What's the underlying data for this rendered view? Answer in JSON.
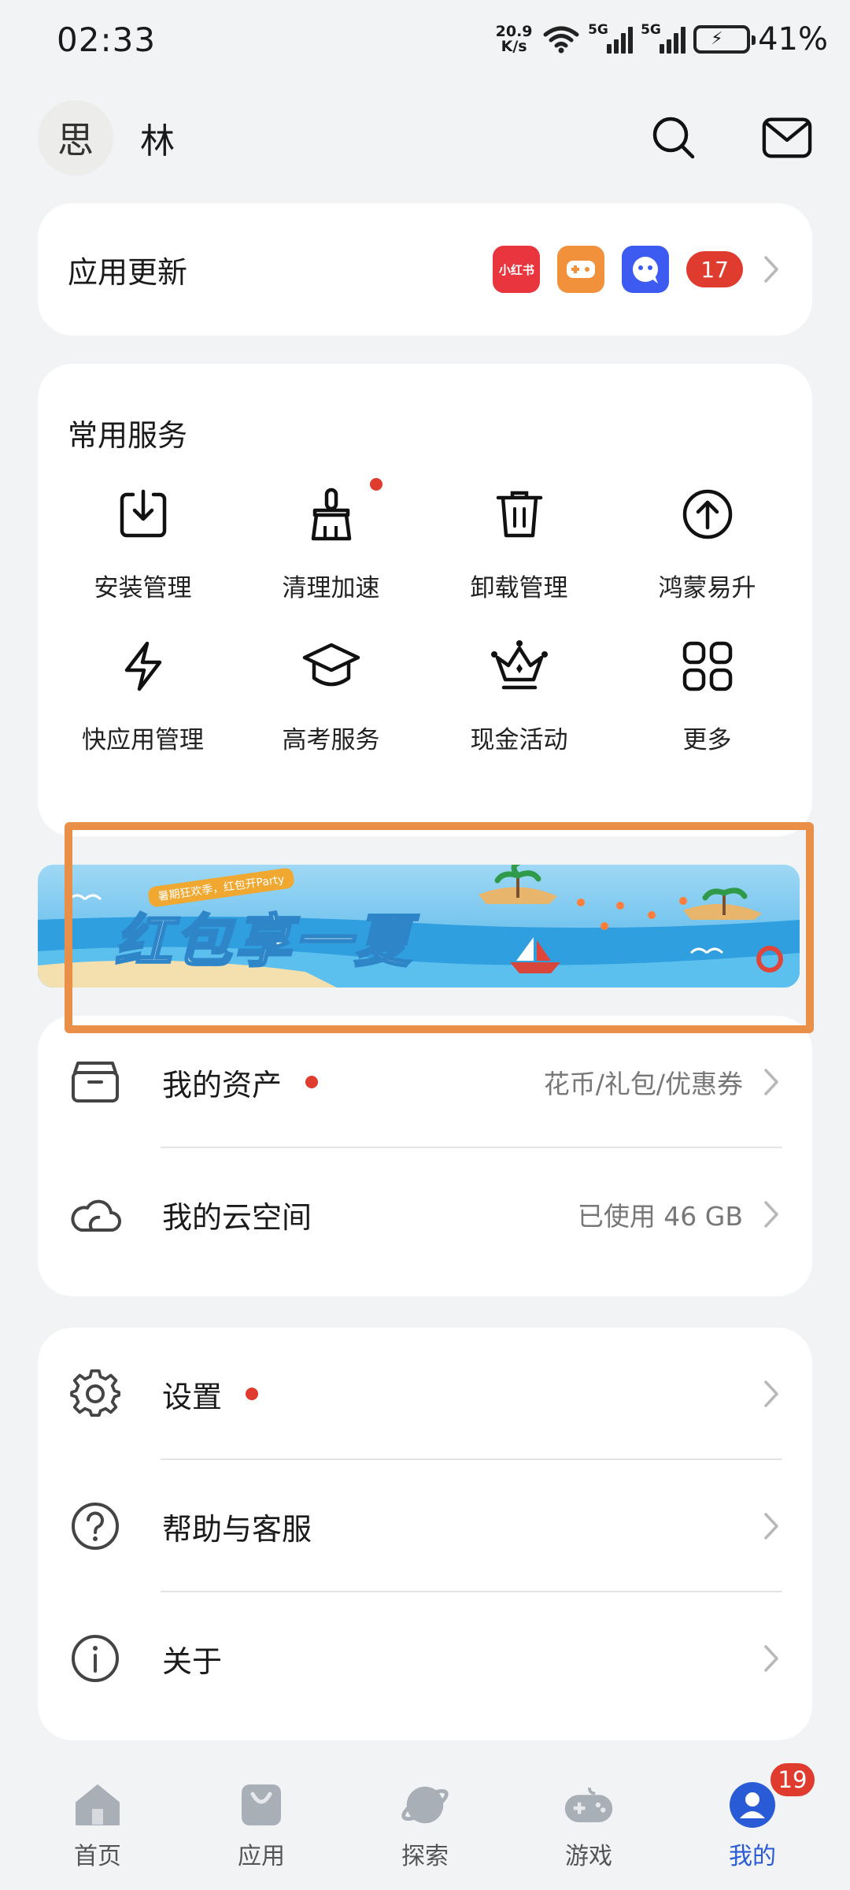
{
  "status_bar": {
    "time": "02:33",
    "net_speed_value": "20.9",
    "net_speed_unit": "K/s",
    "signal_1": "5G",
    "signal_2": "5G",
    "battery_percent": "41%"
  },
  "profile": {
    "avatar_char": "思",
    "name": "林",
    "search_icon": "search-icon",
    "mail_icon": "mail-icon"
  },
  "app_update": {
    "title": "应用更新",
    "apps": [
      {
        "label": "小红书",
        "color": "#e8353e"
      },
      {
        "label": "",
        "color": "#f2913b"
      },
      {
        "label": "",
        "color": "#3d5bf0"
      }
    ],
    "count": "17"
  },
  "services": {
    "title": "常用服务",
    "items": [
      {
        "label": "安装管理",
        "icon": "download-box-icon"
      },
      {
        "label": "清理加速",
        "icon": "brush-icon",
        "dot": true
      },
      {
        "label": "卸载管理",
        "icon": "trash-icon"
      },
      {
        "label": "鸿蒙易升",
        "icon": "arrow-up-circle-icon"
      },
      {
        "label": "快应用管理",
        "icon": "lightning-icon"
      },
      {
        "label": "高考服务",
        "icon": "graduation-cap-icon"
      },
      {
        "label": "现金活动",
        "icon": "crown-icon"
      },
      {
        "label": "更多",
        "icon": "grid-icon"
      }
    ]
  },
  "banner": {
    "ribbon": "暑期狂欢季，红包开Party",
    "headline": "红包享一夏"
  },
  "assets": {
    "rows": [
      {
        "label": "我的资产",
        "value": "花币/礼包/优惠券",
        "icon": "wallet-box-icon",
        "dot": true
      },
      {
        "label": "我的云空间",
        "value": "已使用 46 GB",
        "icon": "cloud-icon",
        "dot": false
      }
    ]
  },
  "settings": {
    "rows": [
      {
        "label": "设置",
        "icon": "gear-icon",
        "dot": true
      },
      {
        "label": "帮助与客服",
        "icon": "question-icon",
        "dot": false
      },
      {
        "label": "关于",
        "icon": "info-icon",
        "dot": false
      }
    ]
  },
  "tabs": [
    {
      "label": "首页",
      "icon": "home-icon"
    },
    {
      "label": "应用",
      "icon": "bag-icon"
    },
    {
      "label": "探索",
      "icon": "planet-icon"
    },
    {
      "label": "游戏",
      "icon": "gamepad-icon"
    },
    {
      "label": "我的",
      "icon": "person-icon",
      "active": true,
      "badge": "19"
    }
  ],
  "colors": {
    "accent": "#2a5bd7",
    "badge": "#e03b2f",
    "background": "#f1f3f5",
    "highlight": "#ea8f48"
  }
}
